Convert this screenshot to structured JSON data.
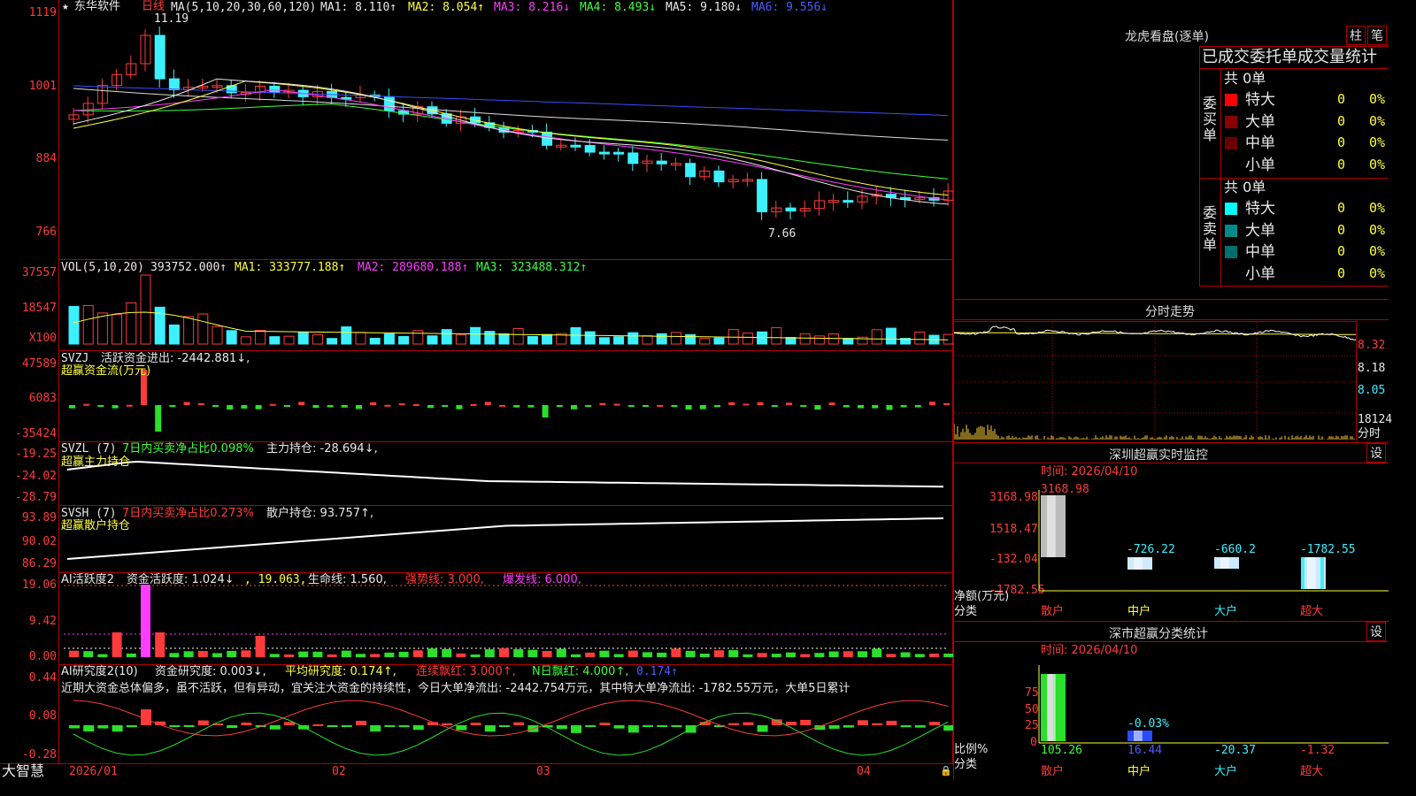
{
  "header": {
    "star": "★",
    "stock_name": "东华软件",
    "period": "日线",
    "ma_label": "MA(5,10,20,30,60,120)",
    "ma1": "MA1: 8.110↑",
    "ma2": "MA2: 8.054↑",
    "ma3": "MA3: 8.216↓",
    "ma4": "MA4: 8.493↓",
    "ma5": "MA5: 9.180↓",
    "ma6": "MA6: 9.556↓",
    "high_mark": "11.19",
    "low_mark": "7.66"
  },
  "price_axis": [
    "1119",
    "1001",
    "884",
    "766"
  ],
  "vol": {
    "label": "VOL(5,10,20)",
    "value": "393752.000↑",
    "ma1": "MA1: 333777.188↑",
    "ma2": "MA2: 289680.188↑",
    "ma3": "MA3: 323488.312↑",
    "axis": [
      "37557",
      "18547",
      "X100"
    ]
  },
  "svzj": {
    "title": "SVZJ",
    "active_flow": "活跃资金进出: -2442.881↓,",
    "sub": "超赢资金流(万元)",
    "axis": [
      "47589",
      "6083",
      "-35424"
    ]
  },
  "svzl": {
    "title": "SVZL (7)",
    "ratio": "7日内买卖净占比0.098%",
    "main_hold": "主力持仓: -28.694↓,",
    "sub": "超赢主力持仓",
    "axis": [
      "-19.25",
      "-24.02",
      "-28.79"
    ]
  },
  "svsh": {
    "title": "SVSH (7)",
    "ratio": "7日内买卖净占比0.273%",
    "retail_hold": "散户持仓: 93.757↑,",
    "sub": "超赢散户持仓",
    "axis": [
      "93.89",
      "90.02",
      "86.29"
    ]
  },
  "ai_active": {
    "title": "AI活跃度2",
    "activity": "资金活跃度: 1.024↓",
    "v2": ", 19.063,",
    "life": "生命线: 1.560,",
    "strong": "强势线: 3.000,",
    "burst": "爆发线: 6.000,",
    "axis": [
      "19.06",
      "9.42",
      "0.00"
    ]
  },
  "ai_research": {
    "title": "AI研究度2(10)",
    "research": "资金研究度: 0.003↓,",
    "avg": "平均研究度: 0.174↑,",
    "consecutive": "连续飘红: 3.000↑,",
    "nday": "N日飘红: 4.000↑,",
    "last": "0.174↑",
    "summary": "近期大资金总体偏多，虽不活跃，但有异动，宜关注大资金的持续性，今日大单净流出: -2442.754万元，其中特大单净流出: -1782.55万元，大单5日累计",
    "axis": [
      "0.44",
      "0.08",
      "-0.28"
    ]
  },
  "bottom": {
    "brand": "大智慧",
    "dates": [
      "2026/01",
      "02",
      "03",
      "04"
    ]
  },
  "longhu": {
    "title": "龙虎看盘(逐单)",
    "btn1": "柱",
    "btn2": "笔",
    "subtitle": "已成交委托单成交量统计",
    "buy_side": "委买单",
    "sell_side": "委卖单",
    "buy_total": "共 0单",
    "sell_total": "共 0单",
    "buy_rows": [
      {
        "label": "特大",
        "count": "0",
        "pct": "0%",
        "color": "#ff0000"
      },
      {
        "label": "大单",
        "count": "0",
        "pct": "0%",
        "color": "#8b0000"
      },
      {
        "label": "中单",
        "count": "0",
        "pct": "0%",
        "color": "#6a0000"
      },
      {
        "label": "小单",
        "count": "0",
        "pct": "0%",
        "color": ""
      }
    ],
    "sell_rows": [
      {
        "label": "特大",
        "count": "0",
        "pct": "0%",
        "color": "#00ffff"
      },
      {
        "label": "大单",
        "count": "0",
        "pct": "0%",
        "color": "#008a8a"
      },
      {
        "label": "中单",
        "count": "0",
        "pct": "0%",
        "color": "#006f6f"
      },
      {
        "label": "小单",
        "count": "0",
        "pct": "0%",
        "color": ""
      }
    ]
  },
  "fenshi": {
    "title": "分时走势",
    "axis": [
      "8.32",
      "8.18",
      "8.05",
      "18124",
      "分时"
    ]
  },
  "monitor": {
    "title": "深圳超赢实时监控",
    "btn": "设",
    "time": "时间: 2026/04/10",
    "axis": [
      "3168.98",
      "1518.47",
      "-132.04",
      "-1782.55"
    ],
    "ylabel": "净额(万元)",
    "xlabel": "分类",
    "bars": [
      {
        "label": "散户",
        "value": "3168.98"
      },
      {
        "label": "中户",
        "value": "-726.22"
      },
      {
        "label": "大户",
        "value": "-660.2"
      },
      {
        "label": "超大",
        "value": "-1782.55"
      }
    ]
  },
  "classify": {
    "title": "深市超赢分类统计",
    "btn": "设",
    "time": "时间: 2026/04/10",
    "axis": [
      "75",
      "50",
      "25",
      "0"
    ],
    "ylabel": "比例%",
    "xlabel": "分类",
    "small_label": "-0.03%",
    "bars": [
      {
        "label": "散户",
        "value": "105.26"
      },
      {
        "label": "中户",
        "value": "16.44"
      },
      {
        "label": "大户",
        "value": "-20.37"
      },
      {
        "label": "超大",
        "value": "-1.32"
      }
    ]
  },
  "colors": {
    "up": "#ff3b3b",
    "down": "#3cf0ff",
    "border": "#b00000"
  }
}
